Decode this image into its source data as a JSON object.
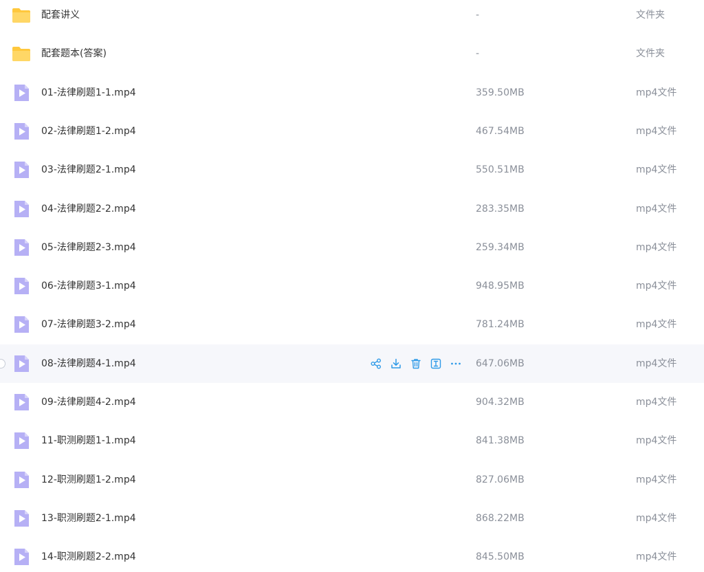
{
  "colors": {
    "folder": "#ffc83d",
    "video_icon_bg": "#b6b0f5",
    "video_icon_play": "#7165e6",
    "action_blue": "#2e9ae8",
    "hover_row_bg": "#f6f7fb"
  },
  "hover_actions": [
    "share-icon",
    "download-icon",
    "delete-icon",
    "rename-icon",
    "more-icon"
  ],
  "files": [
    {
      "name": "配套讲义",
      "size": "-",
      "type": "文件夹",
      "icon": "folder-icon"
    },
    {
      "name": "配套题本(答案)",
      "size": "-",
      "type": "文件夹",
      "icon": "folder-icon"
    },
    {
      "name": "01-法律刷题1-1.mp4",
      "size": "359.50MB",
      "type": "mp4文件",
      "icon": "video-file-icon"
    },
    {
      "name": "02-法律刷题1-2.mp4",
      "size": "467.54MB",
      "type": "mp4文件",
      "icon": "video-file-icon"
    },
    {
      "name": "03-法律刷题2-1.mp4",
      "size": "550.51MB",
      "type": "mp4文件",
      "icon": "video-file-icon"
    },
    {
      "name": "04-法律刷题2-2.mp4",
      "size": "283.35MB",
      "type": "mp4文件",
      "icon": "video-file-icon"
    },
    {
      "name": "05-法律刷题2-3.mp4",
      "size": "259.34MB",
      "type": "mp4文件",
      "icon": "video-file-icon"
    },
    {
      "name": "06-法律刷题3-1.mp4",
      "size": "948.95MB",
      "type": "mp4文件",
      "icon": "video-file-icon"
    },
    {
      "name": "07-法律刷题3-2.mp4",
      "size": "781.24MB",
      "type": "mp4文件",
      "icon": "video-file-icon"
    },
    {
      "name": "08-法律刷题4-1.mp4",
      "size": "647.06MB",
      "type": "mp4文件",
      "icon": "video-file-icon",
      "hovered": true
    },
    {
      "name": "09-法律刷题4-2.mp4",
      "size": "904.32MB",
      "type": "mp4文件",
      "icon": "video-file-icon"
    },
    {
      "name": "11-职测刷题1-1.mp4",
      "size": "841.38MB",
      "type": "mp4文件",
      "icon": "video-file-icon"
    },
    {
      "name": "12-职测刷题1-2.mp4",
      "size": "827.06MB",
      "type": "mp4文件",
      "icon": "video-file-icon"
    },
    {
      "name": "13-职测刷题2-1.mp4",
      "size": "868.22MB",
      "type": "mp4文件",
      "icon": "video-file-icon"
    },
    {
      "name": "14-职测刷题2-2.mp4",
      "size": "845.50MB",
      "type": "mp4文件",
      "icon": "video-file-icon"
    }
  ]
}
